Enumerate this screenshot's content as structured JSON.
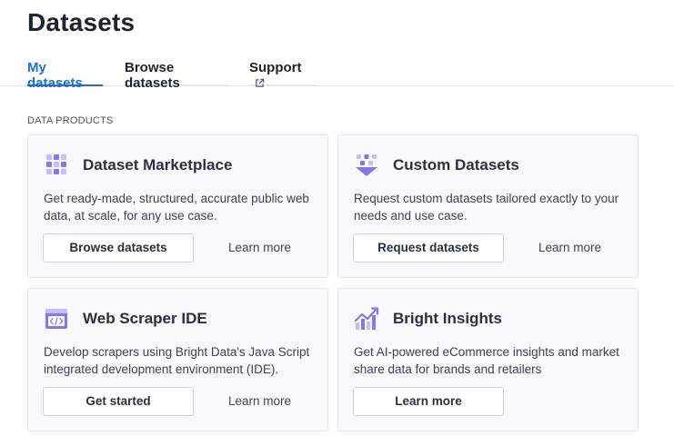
{
  "page": {
    "title": "Datasets"
  },
  "tabs": [
    {
      "label": "My datasets",
      "active": true
    },
    {
      "label": "Browse datasets",
      "active": false
    },
    {
      "label": "Support",
      "active": false,
      "icon": "external-link-icon"
    }
  ],
  "section": {
    "label": "DATA PRODUCTS"
  },
  "colors": {
    "accent": "#1f6dd6",
    "icon_purple": "#8b74f0",
    "icon_light": "#c9bcf9"
  },
  "cards": [
    {
      "icon": "grid-icon",
      "title": "Dataset Marketplace",
      "description": "Get ready-made, structured, accurate public web data, at scale, for any use case.",
      "button": "Browse datasets",
      "link": "Learn more"
    },
    {
      "icon": "funnel-icon",
      "title": "Custom Datasets",
      "description": "Request custom datasets tailored exactly to your needs and use case.",
      "button": "Request datasets",
      "link": "Learn more"
    },
    {
      "icon": "code-window-icon",
      "title": "Web Scraper IDE",
      "description": "Develop scrapers using Bright Data's Java Script integrated development environment (IDE).",
      "button": "Get started",
      "link": "Learn more"
    },
    {
      "icon": "chart-trend-icon",
      "title": "Bright Insights",
      "description": "Get AI-powered eCommerce insights and market share data for brands and retailers",
      "button": "Learn more"
    }
  ]
}
